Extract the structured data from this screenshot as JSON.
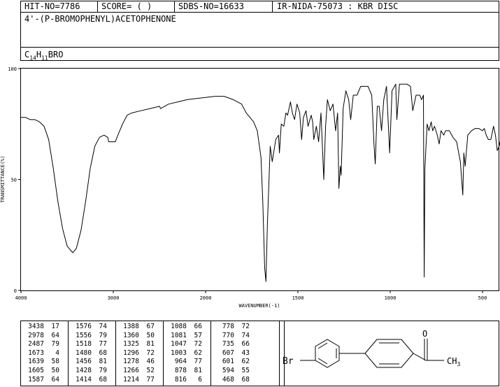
{
  "header": {
    "hit_no": "HIT-NO=7786",
    "score": "SCORE=  (   )",
    "sdbs_no": "SDBS-NO=16633",
    "ir_info": "IR-NIDA-75073 : KBR DISC",
    "compound_name": "4'-(P-BROMOPHENYL)ACETOPHENONE",
    "formula_parts": [
      "C",
      "14",
      "H",
      "11",
      "BRO"
    ]
  },
  "chart_data": {
    "type": "line",
    "title": "",
    "xlabel": "WAVENUMBER(-1)",
    "ylabel": "TRANSMITTANCE(%)",
    "xlim": [
      4000,
      400
    ],
    "ylim": [
      0,
      100
    ],
    "x_ticks": [
      4000,
      3000,
      2000,
      1500,
      1000,
      500
    ],
    "y_ticks": [
      0,
      50,
      100
    ],
    "grid": false,
    "series": [
      {
        "x": [
          4000,
          3950,
          3900,
          3850,
          3800,
          3750,
          3700,
          3650,
          3600,
          3550,
          3500,
          3450,
          3438,
          3400,
          3350,
          3300,
          3250,
          3200,
          3150,
          3100,
          3060,
          3050,
          3040,
          3000,
          2978,
          2950,
          2900,
          2850,
          2800,
          2700,
          2600,
          2500,
          2487,
          2400,
          2300,
          2200,
          2100,
          2000,
          1950,
          1900,
          1850,
          1805,
          1780,
          1760,
          1740,
          1720,
          1700,
          1690,
          1680,
          1673,
          1665,
          1650,
          1639,
          1620,
          1605,
          1600,
          1590,
          1576,
          1565,
          1556,
          1540,
          1530,
          1518,
          1505,
          1490,
          1480,
          1470,
          1456,
          1445,
          1428,
          1420,
          1414,
          1400,
          1388,
          1375,
          1360,
          1350,
          1340,
          1325,
          1310,
          1296,
          1285,
          1278,
          1270,
          1266,
          1255,
          1240,
          1225,
          1214,
          1200,
          1180,
          1160,
          1140,
          1120,
          1100,
          1088,
          1081,
          1070,
          1060,
          1047,
          1035,
          1020,
          1003,
          990,
          970,
          964,
          950,
          930,
          910,
          890,
          878,
          860,
          840,
          830,
          820,
          816,
          812,
          800,
          790,
          778,
          770,
          760,
          745,
          735,
          725,
          710,
          700,
          680,
          660,
          640,
          620,
          607,
          601,
          594,
          580,
          560,
          540,
          520,
          500,
          490,
          480,
          468,
          455,
          440,
          430,
          420,
          410,
          400
        ],
        "y": [
          78,
          78,
          77,
          77,
          76,
          74,
          68,
          55,
          40,
          28,
          20,
          17.5,
          17,
          19,
          27,
          40,
          55,
          65,
          69,
          70,
          69,
          67,
          67,
          67,
          67,
          70,
          75,
          79,
          80,
          81,
          82,
          83,
          82,
          84,
          85,
          86,
          86.5,
          87,
          87.5,
          87.5,
          86,
          84,
          80,
          78,
          76,
          72,
          60,
          40,
          10,
          4,
          30,
          65,
          58,
          68,
          70,
          62,
          75,
          74,
          80,
          79,
          85,
          80,
          77,
          84,
          80,
          68,
          78,
          81,
          74,
          79,
          76,
          68,
          74,
          67,
          80,
          50,
          74,
          86,
          81,
          84,
          72,
          80,
          46,
          56,
          52,
          82,
          90,
          86,
          77,
          88,
          88,
          92,
          92,
          92,
          88,
          66,
          57,
          83,
          83,
          72,
          86,
          92,
          62,
          90,
          93,
          77,
          93,
          93,
          93,
          92,
          81,
          88,
          88,
          86,
          88,
          6,
          55,
          75,
          72,
          76,
          72,
          74,
          70,
          66,
          72,
          70,
          72,
          72,
          69,
          67,
          58,
          43,
          62,
          56,
          70,
          72,
          73,
          73,
          72,
          73,
          70,
          68,
          68,
          74,
          70,
          63,
          65,
          69
        ]
      }
    ],
    "peak_table": [
      [
        [
          3438,
          17
        ],
        [
          2978,
          64
        ],
        [
          2487,
          79
        ],
        [
          1673,
          4
        ],
        [
          1639,
          58
        ],
        [
          1605,
          50
        ],
        [
          1587,
          64
        ]
      ],
      [
        [
          1576,
          74
        ],
        [
          1556,
          79
        ],
        [
          1518,
          77
        ],
        [
          1480,
          68
        ],
        [
          1456,
          81
        ],
        [
          1428,
          79
        ],
        [
          1414,
          68
        ]
      ],
      [
        [
          1388,
          67
        ],
        [
          1360,
          50
        ],
        [
          1325,
          81
        ],
        [
          1296,
          72
        ],
        [
          1278,
          46
        ],
        [
          1266,
          52
        ],
        [
          1214,
          77
        ]
      ],
      [
        [
          1088,
          66
        ],
        [
          1081,
          57
        ],
        [
          1047,
          72
        ],
        [
          1003,
          62
        ],
        [
          964,
          77
        ],
        [
          878,
          81
        ],
        [
          816,
          6
        ]
      ],
      [
        [
          778,
          72
        ],
        [
          770,
          74
        ],
        [
          735,
          66
        ],
        [
          607,
          43
        ],
        [
          601,
          62
        ],
        [
          594,
          55
        ],
        [
          468,
          68
        ]
      ]
    ]
  },
  "structure": {
    "br_label": "Br",
    "o_label": "O",
    "ch3_label": "CH",
    "ch3_sub": "3"
  }
}
